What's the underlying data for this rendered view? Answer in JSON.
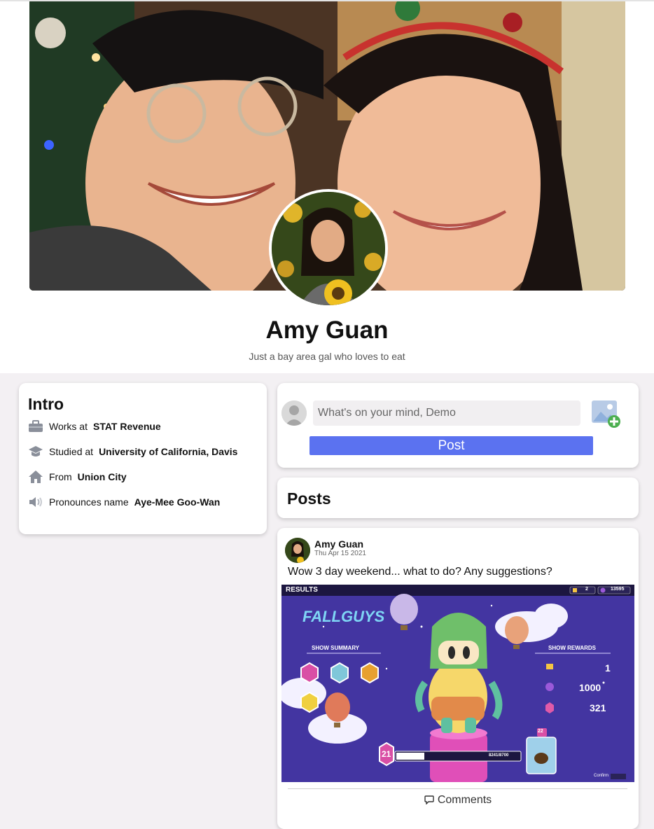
{
  "profile": {
    "name": "Amy Guan",
    "bio": "Just a bay area gal who loves to eat"
  },
  "intro": {
    "title": "Intro",
    "items": [
      {
        "icon": "briefcase-icon",
        "label": "Works at",
        "value": "STAT Revenue"
      },
      {
        "icon": "graduation-cap-icon",
        "label": "Studied at",
        "value": "University of California, Davis"
      },
      {
        "icon": "home-icon",
        "label": "From",
        "value": "Union City"
      },
      {
        "icon": "speaker-icon",
        "label": "Pronounces name",
        "value": "Aye-Mee Goo-Wan"
      }
    ]
  },
  "composer": {
    "placeholder": "What's on your mind, Demo",
    "post_label": "Post",
    "add_photo_icon": "add-photo-icon"
  },
  "posts_section": {
    "title": "Posts"
  },
  "post": {
    "author": "Amy Guan",
    "date": "Thu Apr 15 2021",
    "text": "Wow 3 day weekend... what to do? Any suggestions?",
    "comments_label": "Comments",
    "image": {
      "results_label": "RESULTS",
      "logo_text": "FALLGUYS",
      "show_summary_label": "SHOW SUMMARY",
      "show_rewards_label": "SHOW REWARDS",
      "top_crowns": "2",
      "top_kudos": "13595",
      "reward_crowns": "1",
      "reward_kudos": "1000",
      "reward_fame": "321",
      "level": "21",
      "xp": "8241/8700",
      "unlock_level": "22",
      "confirm_label": "Confirm"
    }
  },
  "colors": {
    "accent": "#5b72f0",
    "page_background": "#f3f0f3"
  }
}
